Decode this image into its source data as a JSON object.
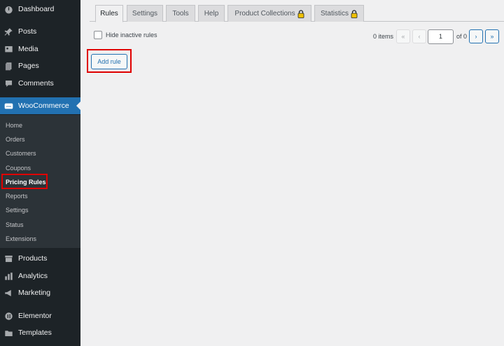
{
  "sidebar": {
    "top_items": [
      {
        "label": "Dashboard",
        "icon": "dashboard-icon"
      },
      {
        "label": "Posts",
        "icon": "pin-icon"
      },
      {
        "label": "Media",
        "icon": "media-icon"
      },
      {
        "label": "Pages",
        "icon": "pages-icon"
      },
      {
        "label": "Comments",
        "icon": "comment-icon"
      }
    ],
    "woocommerce": {
      "label": "WooCommerce",
      "icon": "woo-icon",
      "icon_text": "woo"
    },
    "submenu": [
      {
        "label": "Home"
      },
      {
        "label": "Orders"
      },
      {
        "label": "Customers"
      },
      {
        "label": "Coupons"
      },
      {
        "label": "Pricing Rules",
        "current": true
      },
      {
        "label": "Reports"
      },
      {
        "label": "Settings"
      },
      {
        "label": "Status"
      },
      {
        "label": "Extensions"
      }
    ],
    "bottom_items": [
      {
        "label": "Products",
        "icon": "products-icon"
      },
      {
        "label": "Analytics",
        "icon": "analytics-icon"
      },
      {
        "label": "Marketing",
        "icon": "megaphone-icon"
      },
      {
        "label": "Elementor",
        "icon": "elementor-icon"
      },
      {
        "label": "Templates",
        "icon": "folder-icon"
      }
    ]
  },
  "tabs": [
    {
      "label": "Rules",
      "active": true
    },
    {
      "label": "Settings"
    },
    {
      "label": "Tools"
    },
    {
      "label": "Help"
    },
    {
      "label": "Product Collections",
      "locked": true
    },
    {
      "label": "Statistics",
      "locked": true
    }
  ],
  "filters": {
    "hide_inactive_label": "Hide inactive rules",
    "hide_inactive_checked": false
  },
  "pagination": {
    "items_count": "0 items",
    "first": "«",
    "prev": "‹",
    "current_page": "1",
    "of_text": "of 0",
    "next": "›",
    "last": "»"
  },
  "actions": {
    "add_rule_label": "Add rule"
  },
  "colors": {
    "sidebar_bg": "#1d2327",
    "accent": "#2271b1",
    "highlight": "#e00000",
    "lock": "#f0c000"
  }
}
